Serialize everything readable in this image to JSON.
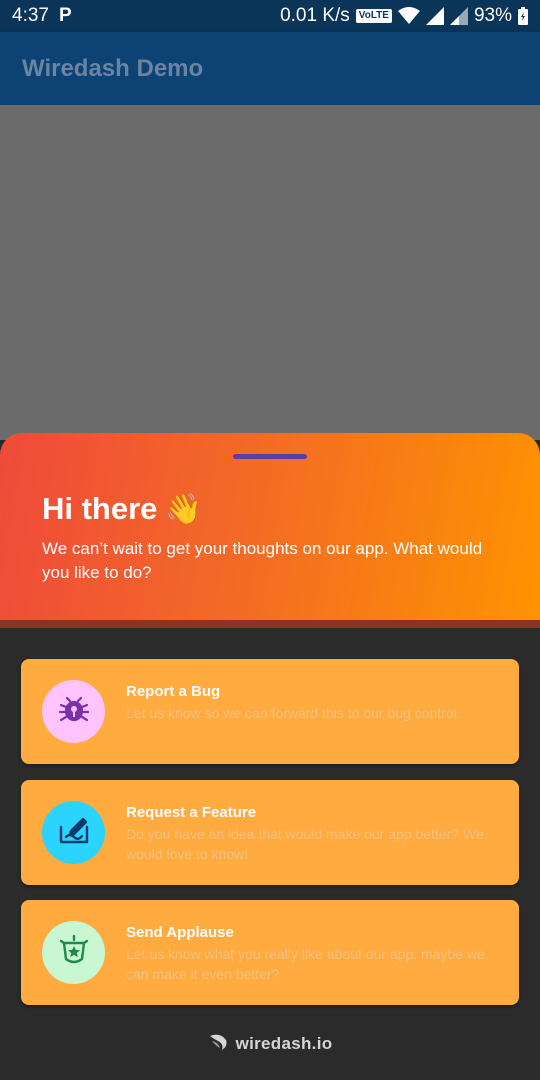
{
  "status_bar": {
    "time": "4:37",
    "notification_icon": "p-icon",
    "network_speed": "0.01 K/s",
    "volte": "VoLTE",
    "battery": "93%"
  },
  "app_bar": {
    "title": "Wiredash Demo"
  },
  "sheet": {
    "greeting": "Hi there",
    "greeting_emoji": "👋",
    "subtitle": "We can’t wait to get your thoughts on our app. What would you like to do?",
    "options": [
      {
        "title": "Report a Bug",
        "description": "Let us know so we can forward this to our bug control.",
        "icon": "bug-icon",
        "icon_bg": "#ffc4ff",
        "icon_color": "#7b2fa8"
      },
      {
        "title": "Request a Feature",
        "description": "Do you have an idea that would make our app better? We would love to know!",
        "icon": "feature-request-icon",
        "icon_bg": "#2bd4ff",
        "icon_color": "#0a3a6a"
      },
      {
        "title": "Send Applause",
        "description": "Let us know what you really like about our app, maybe we can make it even better?",
        "icon": "applause-icon",
        "icon_bg": "#c8f7d2",
        "icon_color": "#1e8a4a"
      }
    ]
  },
  "footer": {
    "brand": "wiredash.io"
  },
  "colors": {
    "status_bar": "#0a3458",
    "app_bar": "#0c4274",
    "header_gradient_start": "#ef4a3a",
    "header_gradient_end": "#ff9300",
    "card": "#ffab40",
    "body": "#2b2b2b"
  }
}
